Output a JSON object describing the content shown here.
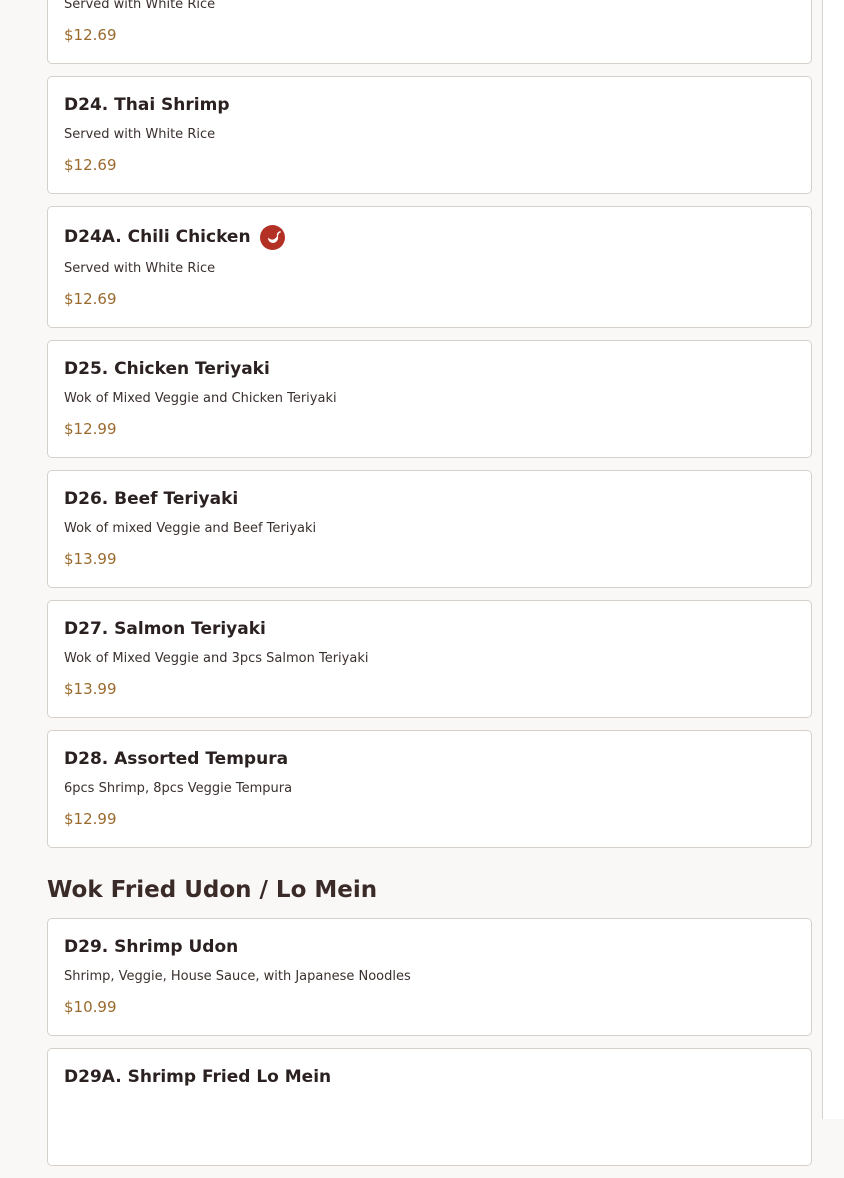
{
  "items_top": [
    {
      "name": "",
      "desc": "Served with White Rice",
      "price": "$12.69"
    },
    {
      "name": "D24. Thai Shrimp",
      "desc": "Served with White Rice",
      "price": "$12.69"
    },
    {
      "name": "D24A. Chili Chicken",
      "desc": "Served with White Rice",
      "price": "$12.69",
      "spicy": true
    },
    {
      "name": "D25. Chicken Teriyaki",
      "desc": "Wok of Mixed Veggie and Chicken Teriyaki",
      "price": "$12.99"
    },
    {
      "name": "D26. Beef Teriyaki",
      "desc": "Wok of mixed Veggie and Beef Teriyaki",
      "price": "$13.99"
    },
    {
      "name": "D27. Salmon Teriyaki",
      "desc": "Wok of Mixed Veggie and 3pcs Salmon Teriyaki",
      "price": "$13.99"
    },
    {
      "name": "D28. Assorted Tempura",
      "desc": "6pcs Shrimp, 8pcs Veggie Tempura",
      "price": "$12.99"
    }
  ],
  "section": {
    "title": "Wok Fried Udon / Lo Mein"
  },
  "items_bottom": [
    {
      "name": "D29. Shrimp Udon",
      "desc": "Shrimp, Veggie, House Sauce, with Japanese Noodles",
      "price": "$10.99"
    },
    {
      "name": "D29A. Shrimp Fried Lo Mein",
      "desc": "",
      "price": ""
    }
  ],
  "icons": {
    "spicy": "chili-pepper-icon"
  },
  "colors": {
    "price": "#9a6a2e",
    "spicy_badge": "#b33024",
    "background": "#faf8f6",
    "card_border": "#d6d0ca"
  }
}
